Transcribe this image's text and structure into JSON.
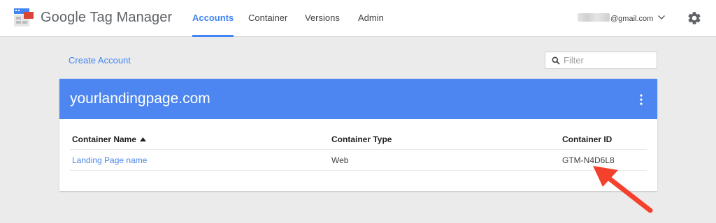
{
  "app": {
    "name": "Google Tag Manager"
  },
  "nav": {
    "items": [
      {
        "label": "Accounts",
        "active": true
      },
      {
        "label": "Container",
        "active": false
      },
      {
        "label": "Versions",
        "active": false
      },
      {
        "label": "Admin",
        "active": false
      }
    ]
  },
  "account": {
    "email_suffix": "@gmail.com"
  },
  "toolbar": {
    "create_account_label": "Create Account",
    "filter_placeholder": "Filter",
    "filter_value": ""
  },
  "card": {
    "title": "yourlandingpage.com",
    "columns": [
      "Container Name",
      "Container Type",
      "Container ID"
    ],
    "rows": [
      {
        "name": "Landing Page name",
        "type": "Web",
        "id": "GTM-N4D6L8"
      }
    ]
  },
  "colors": {
    "accent": "#4285f4",
    "header_bar": "#4d86f0",
    "annotation_arrow": "#f4412d",
    "background": "#ebebeb"
  },
  "icons": [
    "gtm-logo-icon",
    "chevron-down-icon",
    "gear-icon",
    "search-icon",
    "more-vert-icon",
    "sort-asc-icon",
    "annotation-arrow-icon"
  ]
}
